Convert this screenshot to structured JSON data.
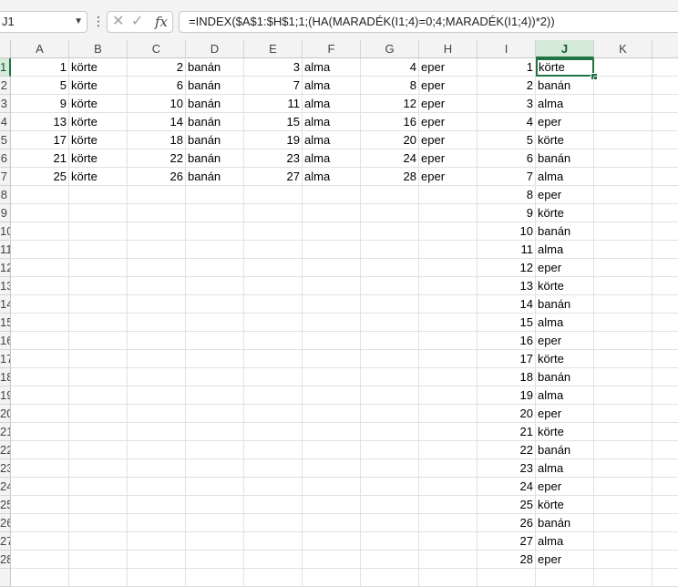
{
  "formula_bar": {
    "name_box": "J1",
    "formula": "=INDEX($A$1:$H$1;1;(HA(MARADÉK(I1;4)=0;4;MARADÉK(I1;4))*2))"
  },
  "grid": {
    "columns": [
      "A",
      "B",
      "C",
      "D",
      "E",
      "F",
      "G",
      "H",
      "I",
      "J",
      "K"
    ],
    "selected_column": "J",
    "rows": [
      "1",
      "2",
      "3",
      "4",
      "5",
      "6",
      "7",
      "8",
      "9",
      "10",
      "11",
      "12",
      "13",
      "14",
      "15",
      "16",
      "17",
      "18",
      "19",
      "20",
      "21",
      "22",
      "23",
      "24",
      "25",
      "26",
      "27",
      "28",
      ""
    ],
    "selected_row": "1",
    "active_cell": "J1",
    "cells": {
      "A": [
        "1",
        "5",
        "9",
        "13",
        "17",
        "21",
        "25"
      ],
      "B": [
        "körte",
        "körte",
        "körte",
        "körte",
        "körte",
        "körte",
        "körte"
      ],
      "C": [
        "2",
        "6",
        "10",
        "14",
        "18",
        "22",
        "26"
      ],
      "D": [
        "banán",
        "banán",
        "banán",
        "banán",
        "banán",
        "banán",
        "banán"
      ],
      "E": [
        "3",
        "7",
        "11",
        "15",
        "19",
        "23",
        "27"
      ],
      "F": [
        "alma",
        "alma",
        "alma",
        "alma",
        "alma",
        "alma",
        "alma"
      ],
      "G": [
        "4",
        "8",
        "12",
        "16",
        "20",
        "24",
        "28"
      ],
      "H": [
        "eper",
        "eper",
        "eper",
        "eper",
        "eper",
        "eper",
        "eper"
      ],
      "I": [
        "1",
        "2",
        "3",
        "4",
        "5",
        "6",
        "7",
        "8",
        "9",
        "10",
        "11",
        "12",
        "13",
        "14",
        "15",
        "16",
        "17",
        "18",
        "19",
        "20",
        "21",
        "22",
        "23",
        "24",
        "25",
        "26",
        "27",
        "28"
      ],
      "J": [
        "körte",
        "banán",
        "alma",
        "eper",
        "körte",
        "banán",
        "alma",
        "eper",
        "körte",
        "banán",
        "alma",
        "eper",
        "körte",
        "banán",
        "alma",
        "eper",
        "körte",
        "banán",
        "alma",
        "eper",
        "körte",
        "banán",
        "alma",
        "eper",
        "körte",
        "banán",
        "alma",
        "eper"
      ]
    }
  },
  "icons": {
    "dropdown": "chevron-down-icon",
    "more": "more-vertical-icon",
    "cancel": "close-icon",
    "enter": "check-icon",
    "function": "fx-icon"
  },
  "colors": {
    "accent": "#217346",
    "header_bg": "#f3f3f3",
    "selected_header_bg": "#d6ead9"
  }
}
